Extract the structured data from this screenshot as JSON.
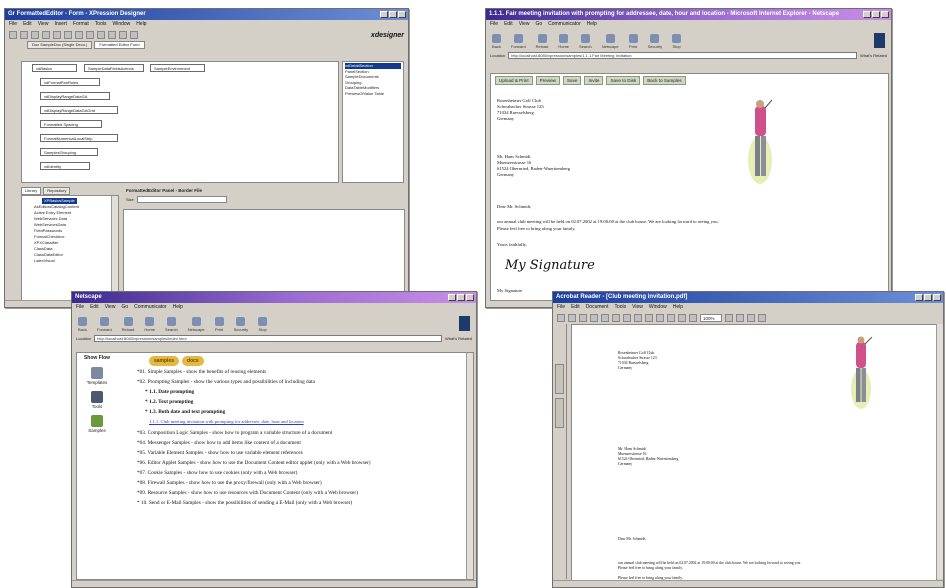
{
  "designer": {
    "title": "Gr FormattedEditor - Form - XPression Designer",
    "menu": [
      "File",
      "Edit",
      "View",
      "Insert",
      "Format",
      "Tools",
      "Window",
      "Help"
    ],
    "brand": "xdesigner",
    "tabs": [
      "Doc SampleDoc (Single Deco.)",
      "Formatted Editor Form"
    ],
    "components": [
      "xdBasics",
      "SampleDataFieldsActions",
      "SampleEnvironment",
      "xdFormatPanRules",
      "xdDisplayRangeDataGA",
      "xdDisplayRangeDataGAGrid",
      "Formatted Spacing",
      "FormatNumericalLocalStrip",
      "SamplesGrouping",
      "xdIdentity"
    ],
    "right_list": [
      "xdDetailSection",
      "PanelSection",
      "SampleDocuments",
      "Grouping",
      "DataTableModifiers",
      "PreviewOfValue Table"
    ],
    "panel_tabs": [
      "Library",
      "Repository"
    ],
    "tree_items": [
      "XPBasicsSample",
      "AsEditorsCatalogContent",
      "Active Entry Element",
      "WebServices Data",
      "WebServicesData",
      "FieldPasswords",
      "FormatCheckbox",
      "XPXClassifier",
      "ClassData",
      "ClassDataEditor",
      "LatexVisual"
    ],
    "editor_title": "FormattedEditor Panel - Border File",
    "editor_field_label": "Size"
  },
  "letter_browser": {
    "title": "1.1.1. Fair meeting invitation with prompting for addressee, date, hour and location - Microsoft Internet Explorer - Netscape",
    "menu": [
      "File",
      "Edit",
      "View",
      "Go",
      "Communicator",
      "Help"
    ],
    "toolbar": [
      "Back",
      "Forward",
      "Reload",
      "Home",
      "Search",
      "Netscape",
      "Print",
      "Security",
      "Stop"
    ],
    "address_label": "Location",
    "address": "http://localhost:8080/xpression/samples/1.1.1.Fair Meeting Invitation",
    "whats_related": "What's Related",
    "nav_buttons": [
      "Upload & Print",
      "Preview",
      "Save",
      "Invite",
      "Save to Disk",
      "Back to Samples"
    ],
    "sender": [
      "Rosenheimer Golf Club",
      "Schwabacher Strasse 123",
      "71034 Ruesselsberg",
      "Germany"
    ],
    "recipient": [
      "Mr. Hans Schmidt",
      "Muenzerstrasse 16",
      "61524 Obernried, Baden-Wuerttemberg",
      "Germany"
    ],
    "salutation": "Dear Mr. Schmidt,",
    "body": [
      "our annual club meeting will be held on 02.07.2002 at 19:00:00 at the club house. We are looking forward to seeing you.",
      "Please feel free to bring along your family."
    ],
    "closing": "Yours faithfully,",
    "signature_image_text": "My Signature",
    "signature_caption": "My Signature"
  },
  "samples_browser": {
    "title": "Netscape",
    "menu": [
      "File",
      "Edit",
      "View",
      "Go",
      "Communicator",
      "Help"
    ],
    "toolbar": [
      "Back",
      "Forward",
      "Reload",
      "Home",
      "Search",
      "Netscape",
      "Print",
      "Security",
      "Stop"
    ],
    "address_label": "Location",
    "address": "http://localhost:8080/xpression/samples/index.html",
    "whats_related": "What's Related",
    "side_heading": "Show Flow",
    "side_items": [
      "Templates",
      "Tools",
      "Samples"
    ],
    "buttons": [
      "samples",
      "docs"
    ],
    "items": [
      {
        "text": "*01. Simple Samples - show the benefits of reusing elements",
        "kind": "main"
      },
      {
        "text": "*02. Prompting Samples - show the various types and possibilities of including data",
        "kind": "main"
      },
      {
        "text": "* 1.1. Date prompting",
        "kind": "sub"
      },
      {
        "text": "* 1.2. Text prompting",
        "kind": "sub"
      },
      {
        "text": "* 1.3. Both date and text prompting",
        "kind": "sub"
      },
      {
        "text": "1.1.1. Club meeting invitation with prompting for addressee, date, hour and location",
        "kind": "link"
      },
      {
        "text": "*03. Composition Logic Samples - show how to program a variable structure of a document",
        "kind": "main"
      },
      {
        "text": "*04. Messenger Samples - show how to add items like content of a document",
        "kind": "main"
      },
      {
        "text": "*05. Variable Element Samples - show how to use variable element references",
        "kind": "main"
      },
      {
        "text": "*06. Editor Applet Samples - show how to use the Document Content editor applet (only with a Web browser)",
        "kind": "main"
      },
      {
        "text": "*07. Cookie Samples - show how to use cookies (only with a Web browser)",
        "kind": "main"
      },
      {
        "text": "*08. Firewall Samples - show how to use the proxy/firewall (only with a Web browser)",
        "kind": "main"
      },
      {
        "text": "*09. Resource Samples - show how to use resources with Document Content (only with a Web browser)",
        "kind": "main"
      },
      {
        "text": "* 10. Send or E-Mail Samples - show the possibilities of sending a E-Mail (only with a Web browser)",
        "kind": "main"
      }
    ]
  },
  "pdf_viewer": {
    "title": "Acrobat Reader - [Club meeting invitation.pdf]",
    "menu": [
      "File",
      "Edit",
      "Document",
      "Tools",
      "View",
      "Window",
      "Help"
    ],
    "zoom": "100%",
    "sender": [
      "Rosenheimer Golf Club",
      "Schwabacher Strasse 123",
      "71034 Ruesselsberg",
      "Germany"
    ],
    "recipient": [
      "Mr. Hans Schmidt",
      "Muenzerstrasse 16",
      "61524 Obernried, Baden-Wuerttemberg",
      "Germany"
    ],
    "salutation": "Dear Mr. Schmidt,",
    "body": [
      "our annual club meeting will be held on 02.07.2002 at 19:00:00 at the club house. We are looking forward to seeing you.",
      "Please feel free to bring along your family."
    ],
    "closing": "Please feel free to bring along your family."
  },
  "colors": {
    "titlebar_blue": "#1c3e9c",
    "titlebar_purple": "#6d3fbf",
    "link": "#2d3bbd",
    "selection": "#123a8c"
  }
}
